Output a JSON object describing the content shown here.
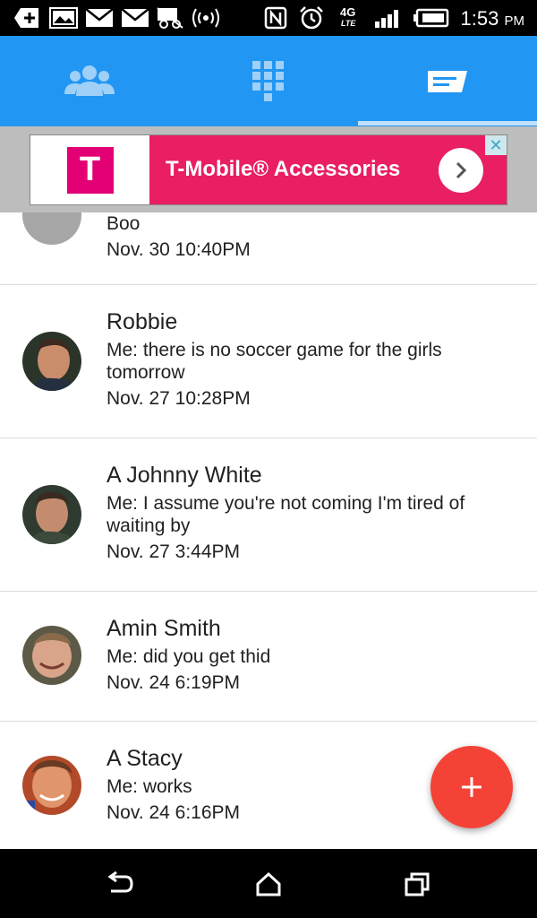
{
  "status_bar": {
    "time": "1:53",
    "ampm": "PM",
    "network": "4G LTE",
    "icons": [
      "add-notification-icon",
      "image-icon",
      "mail-icon",
      "mail-icon",
      "voicemail-off-icon",
      "wireless-icon",
      "nfc-icon",
      "alarm-icon",
      "lte-icon",
      "signal-icon",
      "battery-icon"
    ]
  },
  "tabs": [
    {
      "name": "contacts",
      "icon": "people-icon"
    },
    {
      "name": "dialpad",
      "icon": "dialpad-icon"
    },
    {
      "name": "messages",
      "icon": "message-icon",
      "selected": true
    }
  ],
  "ad": {
    "logo_text": "T",
    "text": "T-Mobile® Accessories",
    "close": "✕"
  },
  "conversations": [
    {
      "name": "",
      "message": "Boo",
      "date": "Nov. 30 10:40PM"
    },
    {
      "name": "Robbie",
      "message": "Me: there is no soccer game for the girls tomorrow",
      "date": "Nov. 27 10:28PM"
    },
    {
      "name": "A Johnny White",
      "message": "Me: I assume you're not coming I'm tired of waiting by",
      "date": "Nov. 27 3:44PM"
    },
    {
      "name": "Amin Smith",
      "message": "Me: did you get thid",
      "date": "Nov. 24 6:19PM"
    },
    {
      "name": "A Stacy",
      "message": "Me: works",
      "date": "Nov. 24 6:16PM"
    }
  ],
  "fab": {
    "label": "+"
  },
  "colors": {
    "primary": "#2196f3",
    "accent": "#f44336",
    "ad_pink": "#e91e63",
    "tmobile_magenta": "#e20074"
  }
}
